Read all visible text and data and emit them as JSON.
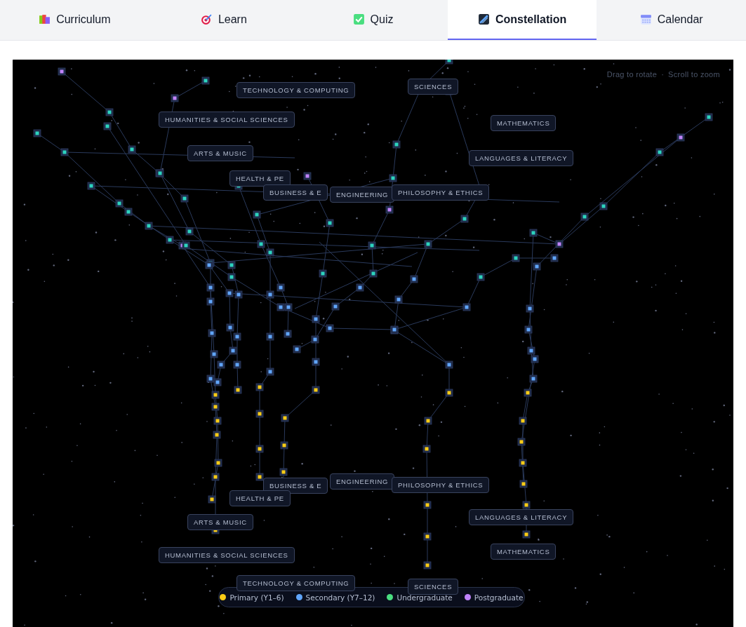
{
  "tabs": [
    {
      "label": "Curriculum",
      "kind": "books",
      "selected": false
    },
    {
      "label": "Learn",
      "kind": "target",
      "selected": false
    },
    {
      "label": "Quiz",
      "kind": "check",
      "selected": false
    },
    {
      "label": "Constellation",
      "kind": "constellation",
      "selected": true
    },
    {
      "label": "Calendar",
      "kind": "calendar",
      "selected": false
    }
  ],
  "hint": {
    "left": "Drag to rotate",
    "separator": "·",
    "right": "Scroll to zoom"
  },
  "category_labels": [
    {
      "label": "TECHNOLOGY & COMPUTING"
    },
    {
      "label": "SCIENCES"
    },
    {
      "label": "HUMANITIES & SOCIAL SCIENCES"
    },
    {
      "label": "MATHEMATICS"
    },
    {
      "label": "ARTS & MUSIC"
    },
    {
      "label": "LANGUAGES & LITERACY"
    },
    {
      "label": "HEALTH & PE"
    },
    {
      "label": "BUSINESS & E"
    },
    {
      "label": "ENGINEERING"
    },
    {
      "label": "PHILOSOPHY & ETHICS"
    },
    {
      "label": "BUSINESS & E"
    },
    {
      "label": "ENGINEERING"
    },
    {
      "label": "PHILOSOPHY & ETHICS"
    },
    {
      "label": "HEALTH & PE"
    },
    {
      "label": "ARTS & MUSIC"
    },
    {
      "label": "LANGUAGES & LITERACY"
    },
    {
      "label": "HUMANITIES & SOCIAL SCIENCES"
    },
    {
      "label": "MATHEMATICS"
    },
    {
      "label": "TECHNOLOGY & COMPUTING"
    },
    {
      "label": "SCIENCES"
    }
  ],
  "legend": [
    {
      "label": "Primary (Y1–6)",
      "color": "#facc15"
    },
    {
      "label": "Secondary (Y7–12)",
      "color": "#60a5fa"
    },
    {
      "label": "Undergraduate",
      "color": "#4ade80"
    },
    {
      "label": "Postgraduate",
      "color": "#c084fc"
    }
  ]
}
